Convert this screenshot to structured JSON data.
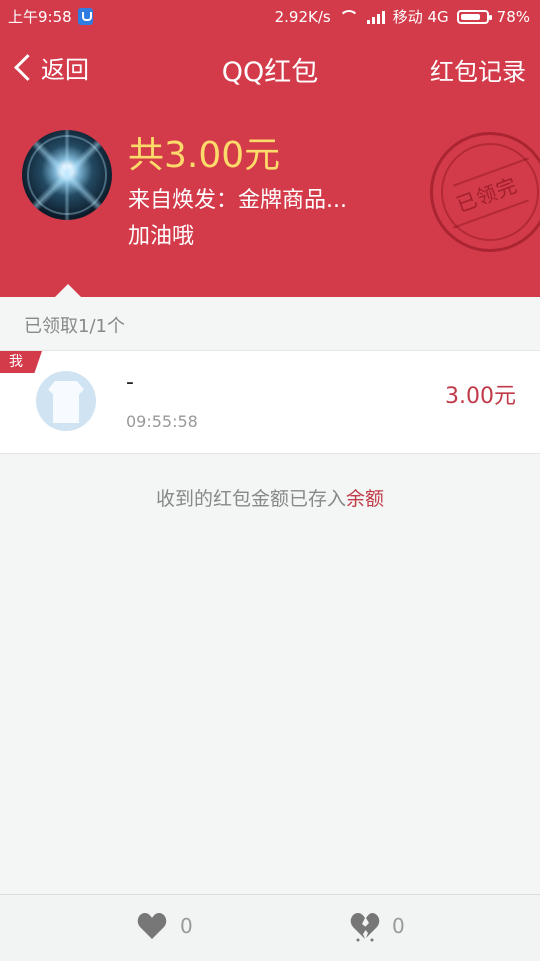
{
  "status": {
    "time": "上午9:58",
    "speed": "2.92K/s",
    "carrier": "移动 4G",
    "battery": "78%",
    "battery_level": 0.78
  },
  "nav": {
    "back_label": "返回",
    "title": "QQ红包",
    "records_label": "红包记录"
  },
  "packet": {
    "amount": "共3.00元",
    "from": "来自焕发：金牌商品...",
    "message": "加油哦",
    "stamp": "已领完"
  },
  "summary": "已领取1/1个",
  "receivers": [
    {
      "tag": "我",
      "name": "-",
      "time": "09:55:58",
      "amount": "3.00元"
    }
  ],
  "note": {
    "text": "收到的红包金额已存入",
    "link": "余额"
  },
  "reactions": {
    "likes": "0",
    "dislikes": "0"
  },
  "colors": {
    "brand_red": "#d33b4a",
    "gold": "#fddb6b",
    "amount_red": "#c03a48"
  }
}
